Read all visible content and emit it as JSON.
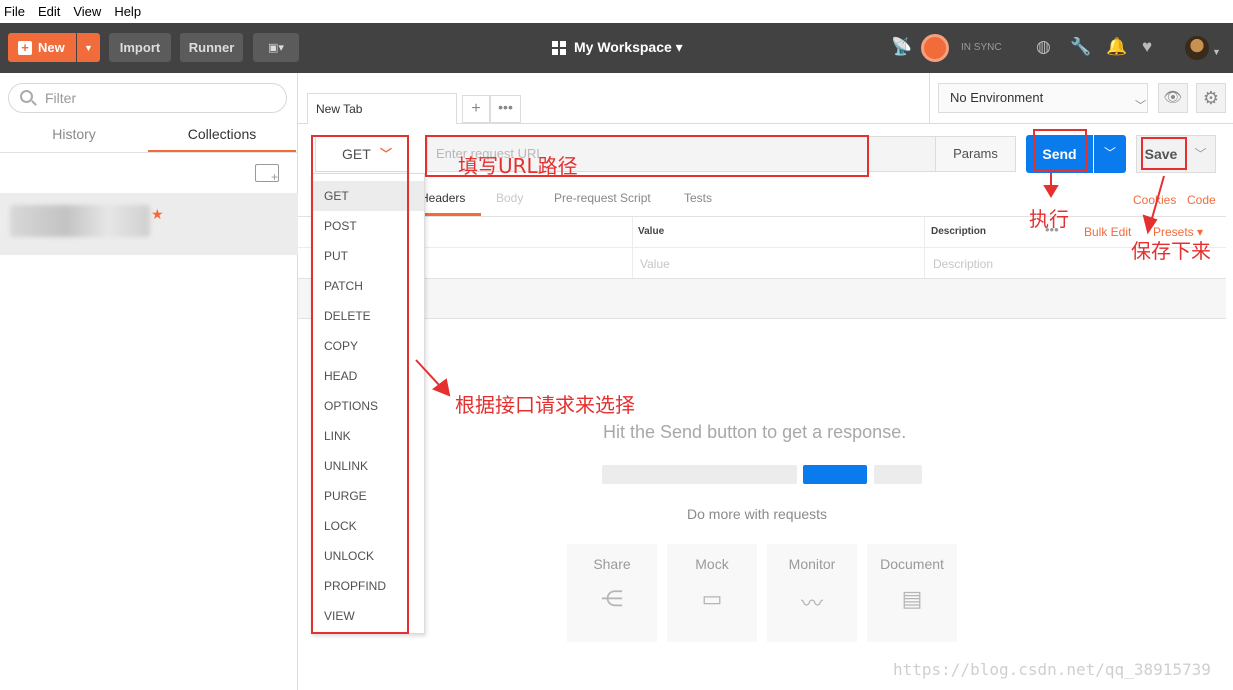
{
  "menubar": {
    "items": [
      "File",
      "Edit",
      "View",
      "Help"
    ]
  },
  "toolbar": {
    "new_label": "New",
    "import_label": "Import",
    "runner_label": "Runner",
    "workspace_label": "My Workspace ▾",
    "sync_label": "IN SYNC"
  },
  "sidebar": {
    "filter_placeholder": "Filter",
    "tabs": [
      "History",
      "Collections"
    ]
  },
  "request": {
    "tab_label": "New Tab",
    "method": "GET",
    "url_placeholder": "Enter request URL",
    "params_label": "Params",
    "send_label": "Send",
    "save_label": "Save"
  },
  "environment": {
    "selected": "No Environment"
  },
  "subtabs": [
    "Headers",
    "Body",
    "Pre-request Script",
    "Tests"
  ],
  "links": {
    "cookies": "Cookies",
    "code": "Code",
    "bulk_edit": "Bulk Edit",
    "presets": "Presets ▾"
  },
  "headers_table": {
    "col_value": "Value",
    "col_description": "Description",
    "ph_value": "Value",
    "ph_description": "Description"
  },
  "response": {
    "hint": "Hit the Send button to get a response.",
    "do_more": "Do more with requests",
    "cards": [
      "Share",
      "Mock",
      "Monitor",
      "Document"
    ]
  },
  "methods": [
    "GET",
    "POST",
    "PUT",
    "PATCH",
    "DELETE",
    "COPY",
    "HEAD",
    "OPTIONS",
    "LINK",
    "UNLINK",
    "PURGE",
    "LOCK",
    "UNLOCK",
    "PROPFIND",
    "VIEW"
  ],
  "annotations": {
    "url": "填写URL路径",
    "execute": "执行",
    "save": "保存下来",
    "method": "根据接口请求来选择"
  },
  "watermark": "https://blog.csdn.net/qq_38915739",
  "colors": {
    "accent": "#f26b3a",
    "send": "#097bed",
    "annotation": "#e53030"
  }
}
